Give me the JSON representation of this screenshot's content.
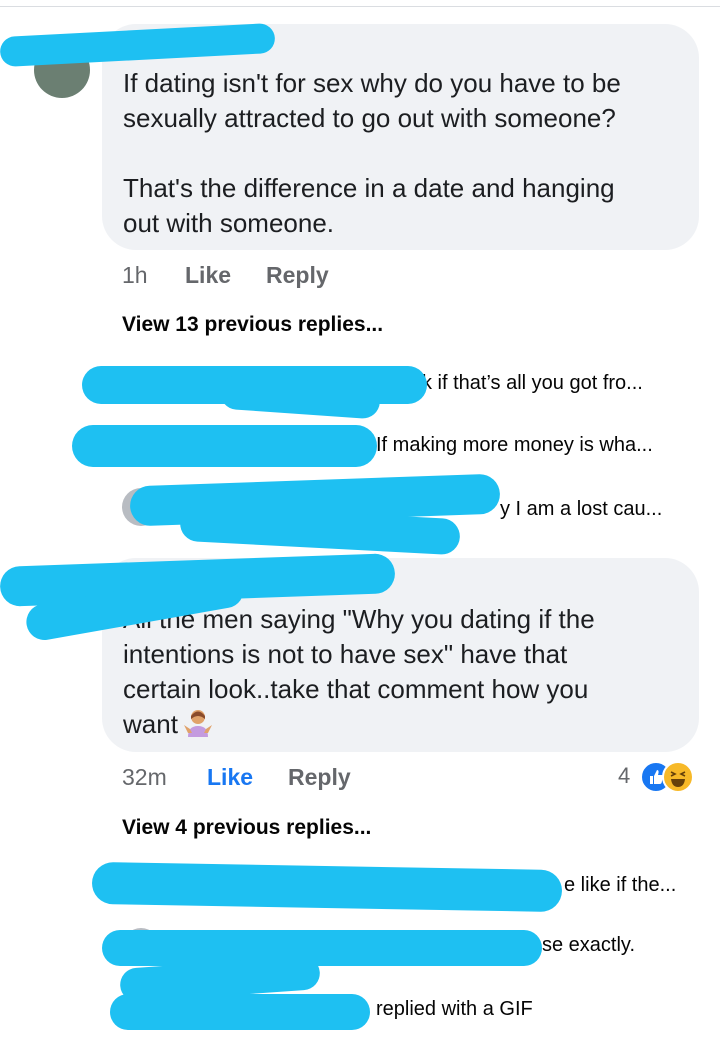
{
  "comments": [
    {
      "text_line1": "If dating isn't for sex why do you have to be",
      "text_line2": "sexually attracted to go out with someone?",
      "text_line3": "That's the difference in a date and hanging",
      "text_line4": "out with someone.",
      "time": "1h",
      "like_label": "Like",
      "reply_label": "Reply",
      "view_replies": "View 13 previous replies...",
      "replies": [
        {
          "snippet": "k if that’s all you got fro..."
        },
        {
          "snippet": "If making more money is wha..."
        },
        {
          "snippet": "y I am a lost cau..."
        }
      ]
    },
    {
      "text_line1": "All the men saying \"Why you dating if the",
      "text_line2": "intentions is not to have sex\" have that",
      "text_line3": "certain look..take that comment how you",
      "text_line4": "want",
      "emoji": "person-shrugging-emoji",
      "time": "32m",
      "like_label": "Like",
      "reply_label": "Reply",
      "reaction_count": "4",
      "reaction_icons": [
        "like-reaction-icon",
        "haha-reaction-icon"
      ],
      "view_replies": "View 4 previous replies...",
      "replies": [
        {
          "snippet": "e like if the..."
        },
        {
          "snippet": "se exactly."
        },
        {
          "snippet": "replied with a GIF"
        }
      ]
    }
  ],
  "colors": {
    "bubble": "#f0f2f5",
    "meta": "#65676b",
    "liked": "#1877f2",
    "redaction": "#1ec0f2"
  }
}
